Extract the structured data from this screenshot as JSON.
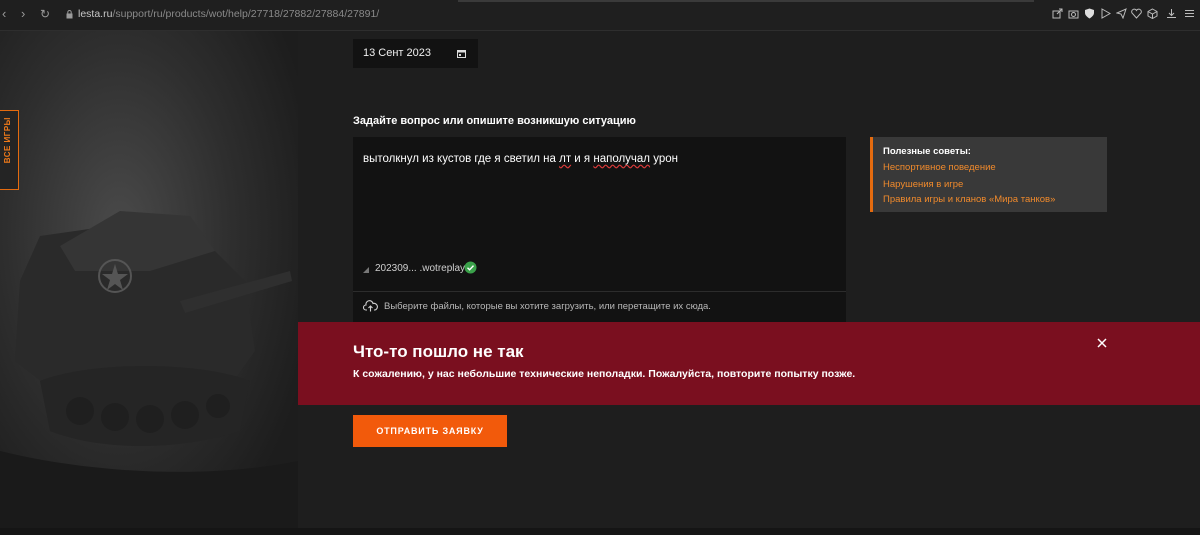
{
  "browser": {
    "url_host": "lesta.ru",
    "url_path": "/support/ru/products/wot/help/27718/27882/27884/27891/"
  },
  "sidebar": {
    "all_games_label": "ВСЕ ИГРЫ"
  },
  "form": {
    "date_value": "13 Сент 2023",
    "question_label": "Задайте вопрос или опишите возникшую ситуацию",
    "text_segments": [
      "вытолкнул из кустов где я светил на ",
      "лт",
      " и я ",
      "наполучал",
      " урон"
    ],
    "attachment_name": "202309... .wotreplay",
    "upload_hint": "Выберите файлы, которые вы хотите загрузить, или перетащите их сюда.",
    "submit_label": "ОТПРАВИТЬ ЗАЯВКУ"
  },
  "tips": {
    "title": "Полезные советы:",
    "links": [
      "Неспортивное поведение",
      "Нарушения в игре",
      "Правила игры и кланов «Мира танков»"
    ]
  },
  "error": {
    "title": "Что-то пошло не так",
    "message": "К сожалению, у нас небольшие технические неполадки. Пожалуйста, повторите попытку позже."
  },
  "colors": {
    "accent": "#f25a0b",
    "link": "#f08a2c",
    "error_bg": "#7a0f1f",
    "success": "#3aa14a"
  }
}
